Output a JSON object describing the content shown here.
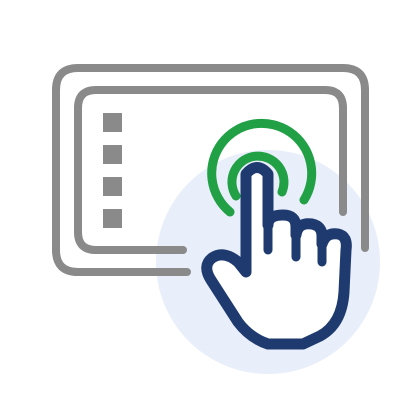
{
  "icon": {
    "name": "touchscreen-tap-icon",
    "colors": {
      "background": "#ffffff",
      "circle_fill": "#e8eefa",
      "frame_gray": "#8a8a8a",
      "tap_ring_green": "#21a046",
      "hand_navy": "#1e3a6e",
      "hand_fill": "#ffffff"
    },
    "menu_items_count": 4
  }
}
